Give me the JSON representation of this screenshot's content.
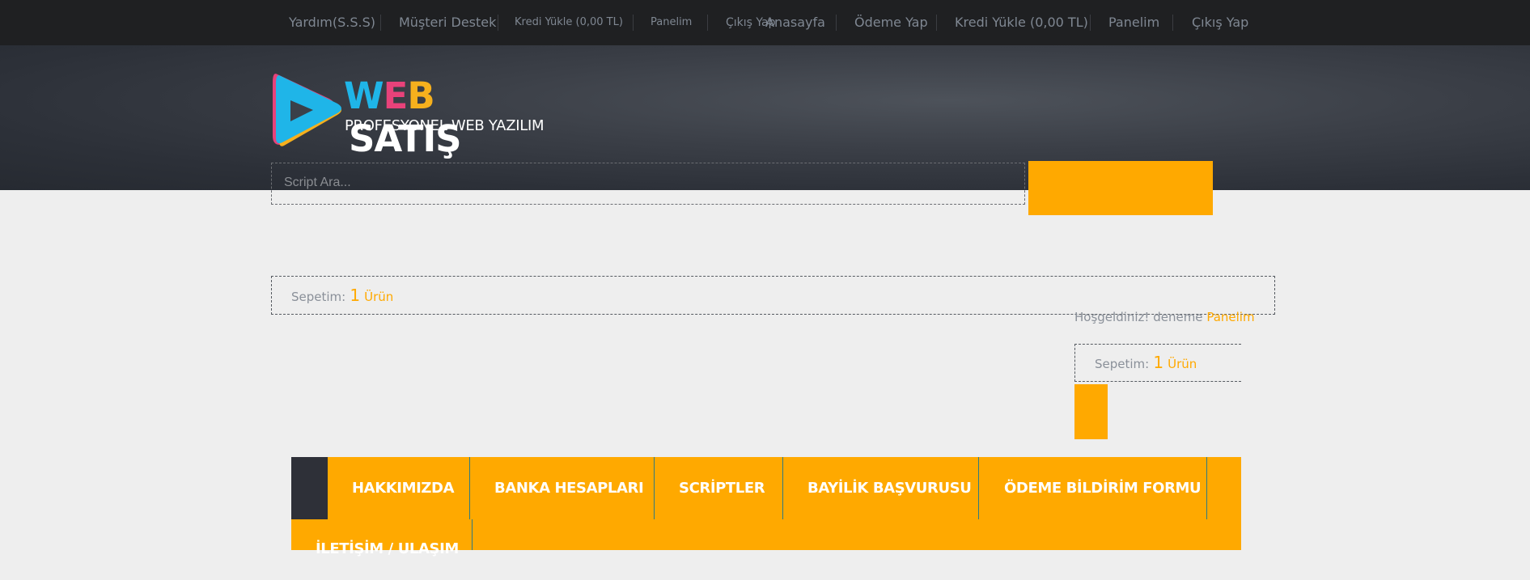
{
  "topbar": {
    "left_links": [
      "Yardım(S.S.S)",
      "Müşteri Destek",
      "Kredi Yükle (0,00 TL)",
      "Panelim",
      "Çıkış Yap"
    ],
    "right_links": [
      "Anasayfa",
      "Ödeme Yap",
      "Kredi Yükle (0,00 TL)",
      "Panelim",
      "Çıkış Yap"
    ]
  },
  "logo": {
    "brand_web": "WEB",
    "brand_satis": "SATIŞ",
    "tagline": "PROFESYONEL WEB YAZILIM",
    "colors": {
      "w": "#1fb5e8",
      "e": "#e8427a",
      "b": "#f6b01d",
      "satis": "#ffffff"
    }
  },
  "search": {
    "placeholder": "Script Ara..."
  },
  "cart_main": {
    "label": "Sepetim:",
    "count": "1",
    "unit": "Ürün"
  },
  "user": {
    "welcome": "Hoşgeldiniz! deneme",
    "panel_link": "Panelim"
  },
  "cart_side": {
    "label": "Sepetim:",
    "count": "1",
    "unit": "Ürün"
  },
  "nav": {
    "items": [
      "HAKKIMIZDA",
      "BANKA HESAPLARI",
      "SCRİPTLER",
      "BAYİLİK BAŞVURUSU",
      "ÖDEME BİLDİRİM FORMU",
      "İLETİŞİM / ULAŞIM"
    ]
  },
  "colors": {
    "accent": "#ffa900",
    "topbar": "#1f2022",
    "nav_dark": "#2e3038"
  }
}
